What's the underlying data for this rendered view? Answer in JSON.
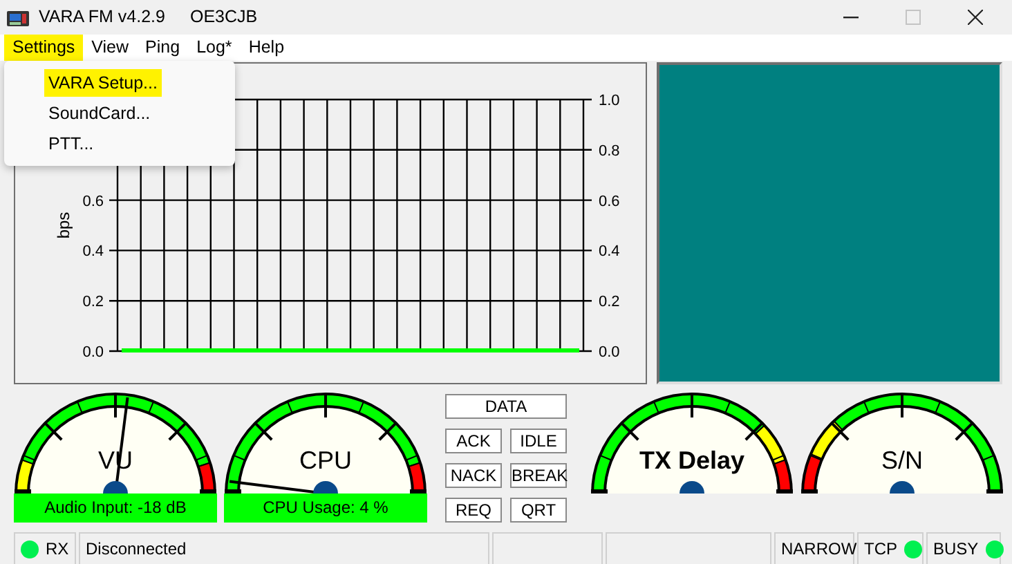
{
  "window": {
    "title": "VARA FM v4.2.9",
    "callsign": "OE3CJB",
    "controls": [
      {
        "kind": "minimize",
        "disabled": false
      },
      {
        "kind": "maximize",
        "disabled": true
      },
      {
        "kind": "close",
        "disabled": false
      }
    ]
  },
  "menu": [
    {
      "label": "Settings",
      "highlighted": true,
      "expanded": true
    },
    {
      "label": "View",
      "highlighted": false,
      "expanded": false
    },
    {
      "label": "Ping",
      "highlighted": false,
      "expanded": false
    },
    {
      "label": "Log*",
      "highlighted": false,
      "expanded": false
    },
    {
      "label": "Help",
      "highlighted": false,
      "expanded": false
    }
  ],
  "dropdown": [
    {
      "label": "VARA Setup...",
      "highlighted": true
    },
    {
      "label": "SoundCard...",
      "highlighted": false
    },
    {
      "label": "PTT...",
      "highlighted": false
    }
  ],
  "chart": {
    "left_tick_labels": [
      "0.6",
      "0.4",
      "0.2",
      "0.0"
    ],
    "chart_data": {
      "type": "line",
      "grid": true,
      "ylabel": "bps",
      "ylim": [
        0,
        1
      ],
      "yticks": [
        {
          "value": 0,
          "label": "0.0"
        },
        {
          "value": 0.2,
          "label": "0.2"
        },
        {
          "value": 0.4,
          "label": "0.4"
        },
        {
          "value": 0.6,
          "label": "0.6"
        },
        {
          "value": 0.8,
          "label": "0.8"
        },
        {
          "value": 1,
          "label": "1.0"
        }
      ],
      "series": [
        {
          "color": "#00ff00",
          "values": [
            0,
            0,
            0,
            0,
            0,
            0,
            0,
            0,
            0,
            0,
            0,
            0,
            0,
            0,
            0,
            0,
            0,
            0,
            0,
            0,
            0
          ]
        }
      ]
    }
  },
  "gauges": [
    {
      "kind": "vu",
      "title": "VU",
      "level": 0.54,
      "reading": "Audio Input: -18 dB"
    },
    {
      "kind": "cpu",
      "title": "CPU",
      "level": 0.04,
      "reading": "CPU Usage: 4 %"
    },
    {
      "kind": "tx-delay",
      "title": "TX Delay"
    },
    {
      "kind": "snr",
      "title": "S/N"
    }
  ],
  "buttons": [
    [
      "DATA"
    ],
    [
      "ACK",
      "IDLE"
    ],
    [
      "NACK",
      "BREAK"
    ],
    [
      "REQ",
      "QRT"
    ]
  ],
  "status_bar": [
    {
      "kind": "led-left",
      "label": "RX",
      "on": true
    },
    {
      "kind": "text",
      "label": "Disconnected"
    },
    {
      "kind": "blank"
    },
    {
      "kind": "blank"
    },
    {
      "kind": "text",
      "label": "NARROW"
    },
    {
      "kind": "led-right",
      "label": "TCP",
      "on": true
    },
    {
      "kind": "led-right",
      "label": "BUSY",
      "on": true
    }
  ]
}
